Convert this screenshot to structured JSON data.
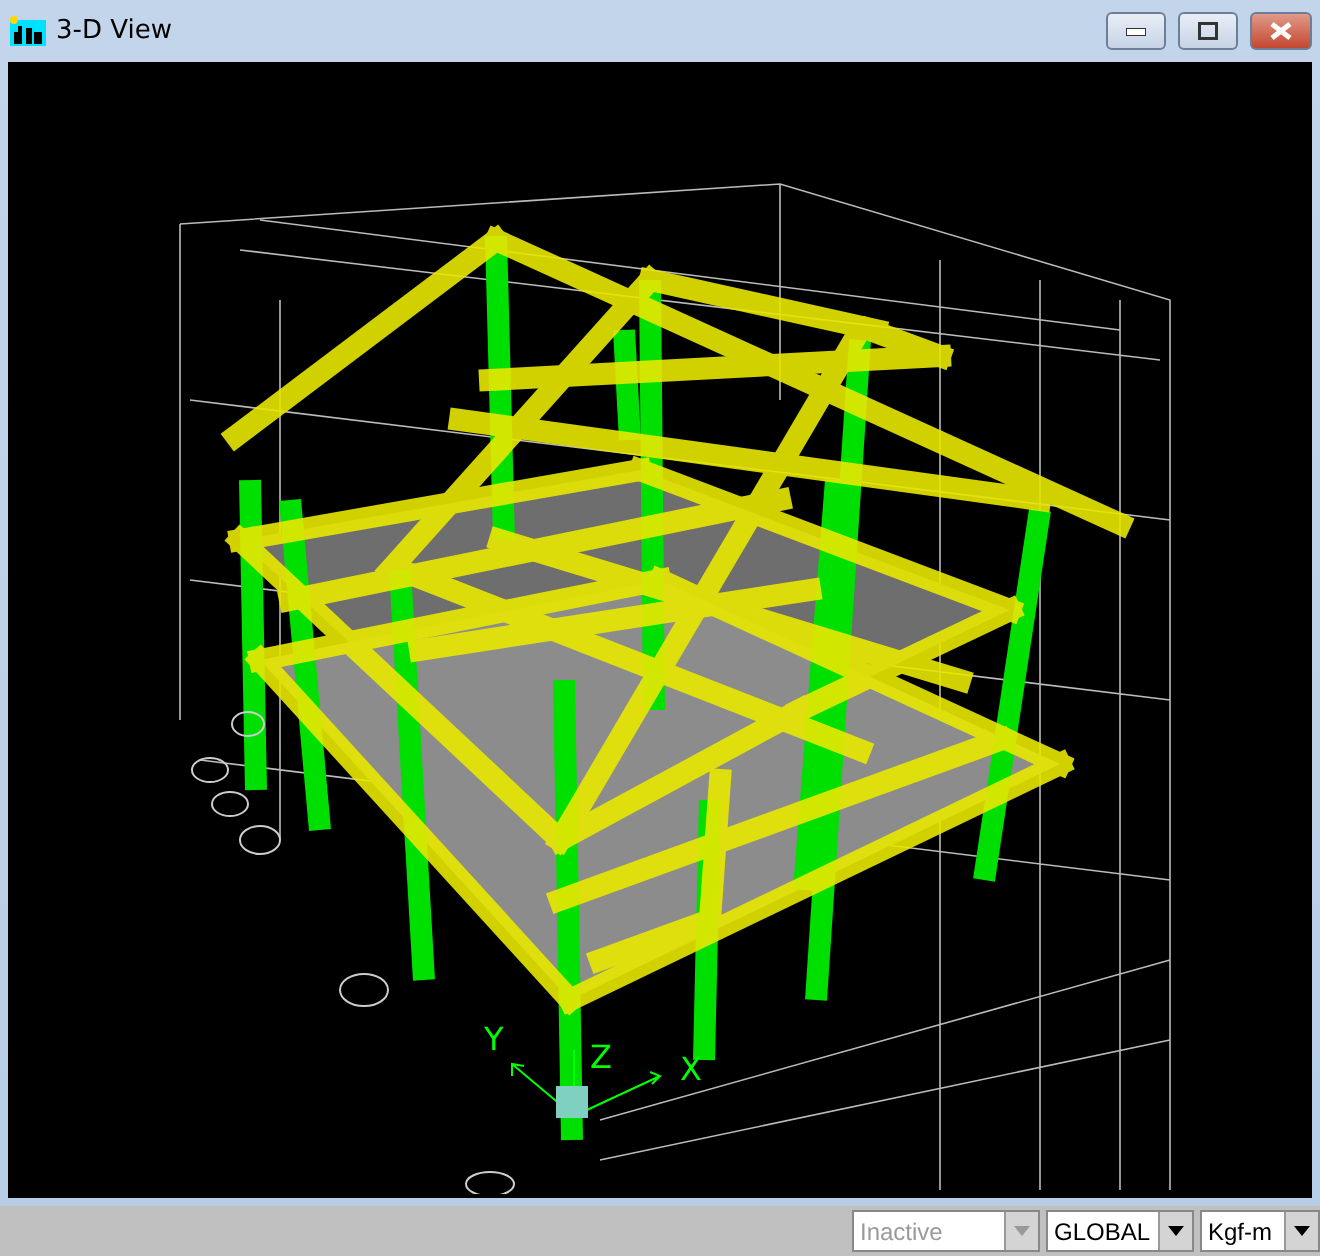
{
  "window": {
    "title": "3-D View"
  },
  "view": {
    "axis_labels": [
      {
        "kind": "x",
        "text": "X"
      },
      {
        "kind": "y",
        "text": "Y"
      },
      {
        "kind": "z",
        "text": "Z"
      }
    ]
  },
  "status_bar": {
    "dropdowns": [
      {
        "value": "Inactive",
        "disabled": true
      },
      {
        "value": "GLOBAL",
        "disabled": false
      },
      {
        "value": "Kgf-m",
        "disabled": false
      }
    ]
  }
}
